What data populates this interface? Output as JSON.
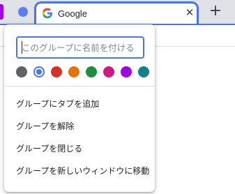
{
  "tab": {
    "title": "Google",
    "close_glyph": "✕",
    "favicon": "google-g-icon"
  },
  "new_tab_glyph": "+",
  "group": {
    "chip_color": "#5b7ff1",
    "edge_color": "#a100e6"
  },
  "dialog": {
    "name_value": "",
    "name_placeholder": "このグループに名前を付ける",
    "colors": [
      {
        "name": "grey",
        "hex": "#5f6368",
        "selected": false
      },
      {
        "name": "blue",
        "hex": "#4a75dc",
        "selected": true
      },
      {
        "name": "red",
        "hex": "#d93025",
        "selected": false
      },
      {
        "name": "yellow",
        "hex": "#e37400",
        "selected": false
      },
      {
        "name": "green",
        "hex": "#1e8e3e",
        "selected": false
      },
      {
        "name": "pink",
        "hex": "#d01884",
        "selected": false
      },
      {
        "name": "purple",
        "hex": "#a100e6",
        "selected": false
      },
      {
        "name": "cyan",
        "hex": "#12828a",
        "selected": false
      }
    ],
    "menu": [
      {
        "label": "グループにタブを追加"
      },
      {
        "label": "グループを解除"
      },
      {
        "label": "グループを閉じる"
      },
      {
        "label": "グループを新しいウィンドウに移動"
      }
    ]
  },
  "theme": {
    "accent": "#4a75dc",
    "tabstrip_bg": "#dee1e6"
  }
}
